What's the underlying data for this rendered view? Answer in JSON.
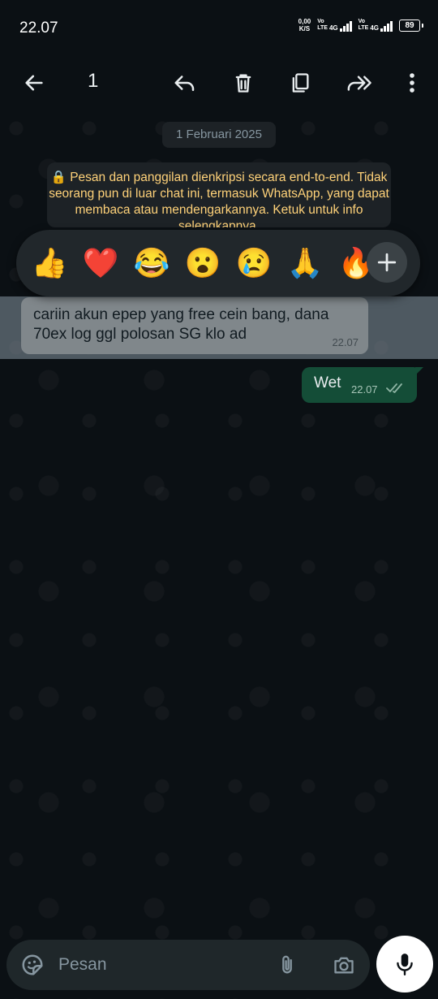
{
  "status_bar": {
    "time": "22.07",
    "net_speed_value": "0,00",
    "net_speed_unit": "K/S",
    "sim1_volte": "Vo\nLTE",
    "sim1_net": "4G",
    "sim2_volte": "Vo\nLTE",
    "sim2_net": "4G",
    "battery": "89"
  },
  "action_bar": {
    "selected_count": "1",
    "icons": [
      "back-arrow-icon",
      "reply-icon",
      "delete-icon",
      "copy-icon",
      "forward-icon",
      "more-icon"
    ]
  },
  "chat": {
    "date_label": "1 Februari 2025",
    "encryption_notice": "🔒 Pesan dan panggilan dienkripsi secara end-to-end. Tidak seorang pun di luar chat ini, termasuk WhatsApp, yang dapat membaca atau mendengarkannya. Ketuk untuk info selengkapnya.",
    "reactions": [
      "👍",
      "❤️",
      "😂",
      "😮",
      "😢",
      "🙏",
      "🔥"
    ],
    "messages": [
      {
        "direction": "in",
        "text": "cariin akun epep yang free cein bang, dana 70ex log ggl polosan SG klo ad",
        "time": "22.07",
        "selected": true
      },
      {
        "direction": "out",
        "text": "Wet",
        "time": "22.07",
        "status": "read"
      }
    ]
  },
  "composer": {
    "placeholder": "Pesan"
  },
  "colors": {
    "background": "#0b1014",
    "outgoing_bubble": "#144d37",
    "notice_text": "#ffd279",
    "read_ticks": "#8fb5a4"
  }
}
